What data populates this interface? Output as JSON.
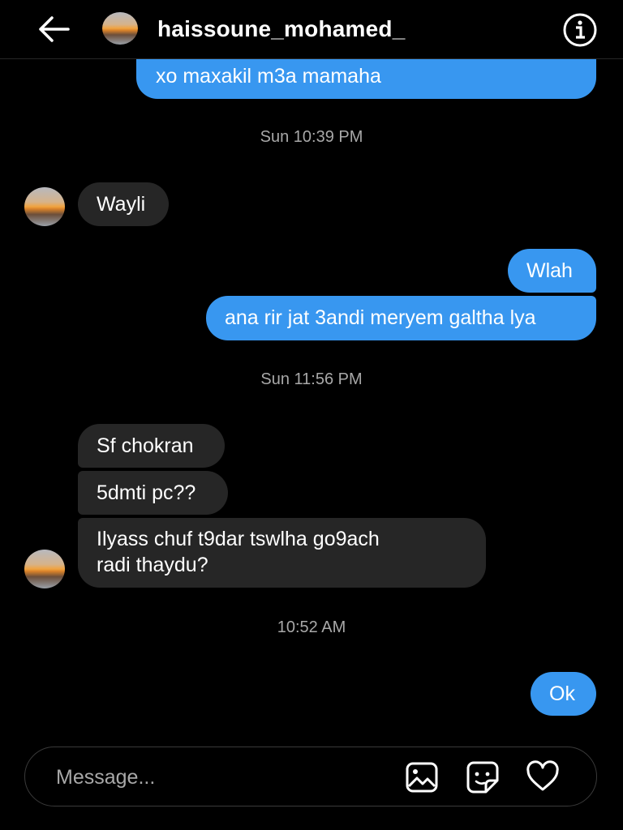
{
  "header": {
    "username": "haissoune_mohamed_",
    "back_icon": "arrow-left-icon",
    "info_icon": "info-icon"
  },
  "messages": [
    {
      "direction": "outgoing",
      "text": "xo maxakil m3a mamaha"
    },
    {
      "type": "timestamp",
      "text": "Sun 10:39 PM"
    },
    {
      "direction": "incoming",
      "text": "Wayli"
    },
    {
      "direction": "outgoing",
      "text": "Wlah"
    },
    {
      "direction": "outgoing",
      "text": "ana rir jat 3andi meryem galtha lya"
    },
    {
      "type": "timestamp",
      "text": "Sun 11:56 PM"
    },
    {
      "direction": "incoming",
      "text": "Sf chokran"
    },
    {
      "direction": "incoming",
      "text": "5dmti pc??"
    },
    {
      "direction": "incoming",
      "text_line1": "Ilyass chuf t9dar tswlha go9ach",
      "text_line2": "radi thaydu?"
    },
    {
      "type": "timestamp",
      "text": "10:52 AM"
    },
    {
      "direction": "outgoing",
      "text": "Ok"
    }
  ],
  "composer": {
    "placeholder": "Message...",
    "icons": [
      "gallery-icon",
      "sticker-icon",
      "heart-icon"
    ]
  },
  "colors": {
    "background": "#000000",
    "outgoing_bubble": "#3897f0",
    "incoming_bubble": "#262626",
    "muted_text": "#a8a8a8"
  }
}
